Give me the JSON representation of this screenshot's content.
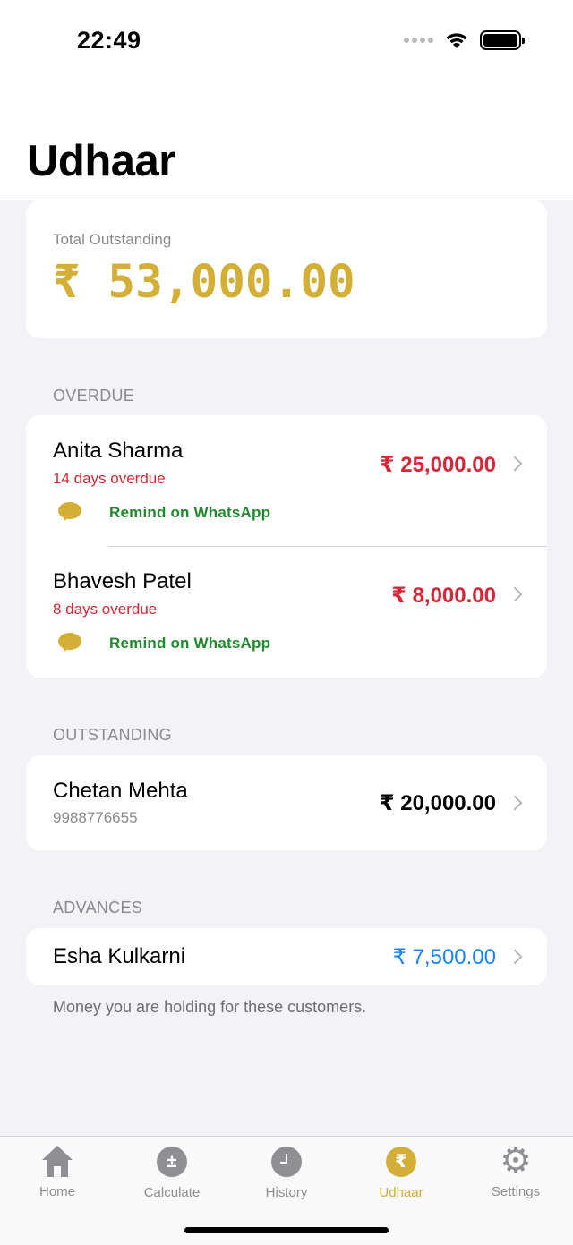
{
  "status_bar": {
    "time": "22:49"
  },
  "header": {
    "title": "Udhaar"
  },
  "summary": {
    "label": "Total Outstanding",
    "amount": "₹ 53,000.00"
  },
  "overdue": {
    "section_title": "OVERDUE",
    "items": [
      {
        "name": "Anita Sharma",
        "status": "14 days overdue",
        "amount": "₹ 25,000.00",
        "action": "Remind on WhatsApp"
      },
      {
        "name": "Bhavesh Patel",
        "status": "8 days overdue",
        "amount": "₹ 8,000.00",
        "action": "Remind on WhatsApp"
      }
    ]
  },
  "outstanding": {
    "section_title": "OUTSTANDING",
    "items": [
      {
        "name": "Chetan Mehta",
        "phone": "9988776655",
        "amount": "₹ 20,000.00"
      }
    ]
  },
  "advances": {
    "section_title": "ADVANCES",
    "items": [
      {
        "name": "Esha Kulkarni",
        "amount": "₹ 7,500.00"
      }
    ],
    "footnote": "Money you are holding for these customers."
  },
  "tab_bar": {
    "tabs": [
      {
        "label": "Home",
        "icon": "home-icon"
      },
      {
        "label": "Calculate",
        "icon": "plus-minus-icon",
        "glyph": "±"
      },
      {
        "label": "History",
        "icon": "clock-icon"
      },
      {
        "label": "Udhaar",
        "icon": "rupee-icon",
        "glyph": "₹",
        "active": true
      },
      {
        "label": "Settings",
        "icon": "gear-icon",
        "glyph": "⚙"
      }
    ]
  },
  "colors": {
    "accent_gold": "#d4af37",
    "overdue_red": "#d72638",
    "whatsapp_green": "#218a2e",
    "advance_blue": "#1a84ff",
    "background": "#f2f2f7"
  }
}
